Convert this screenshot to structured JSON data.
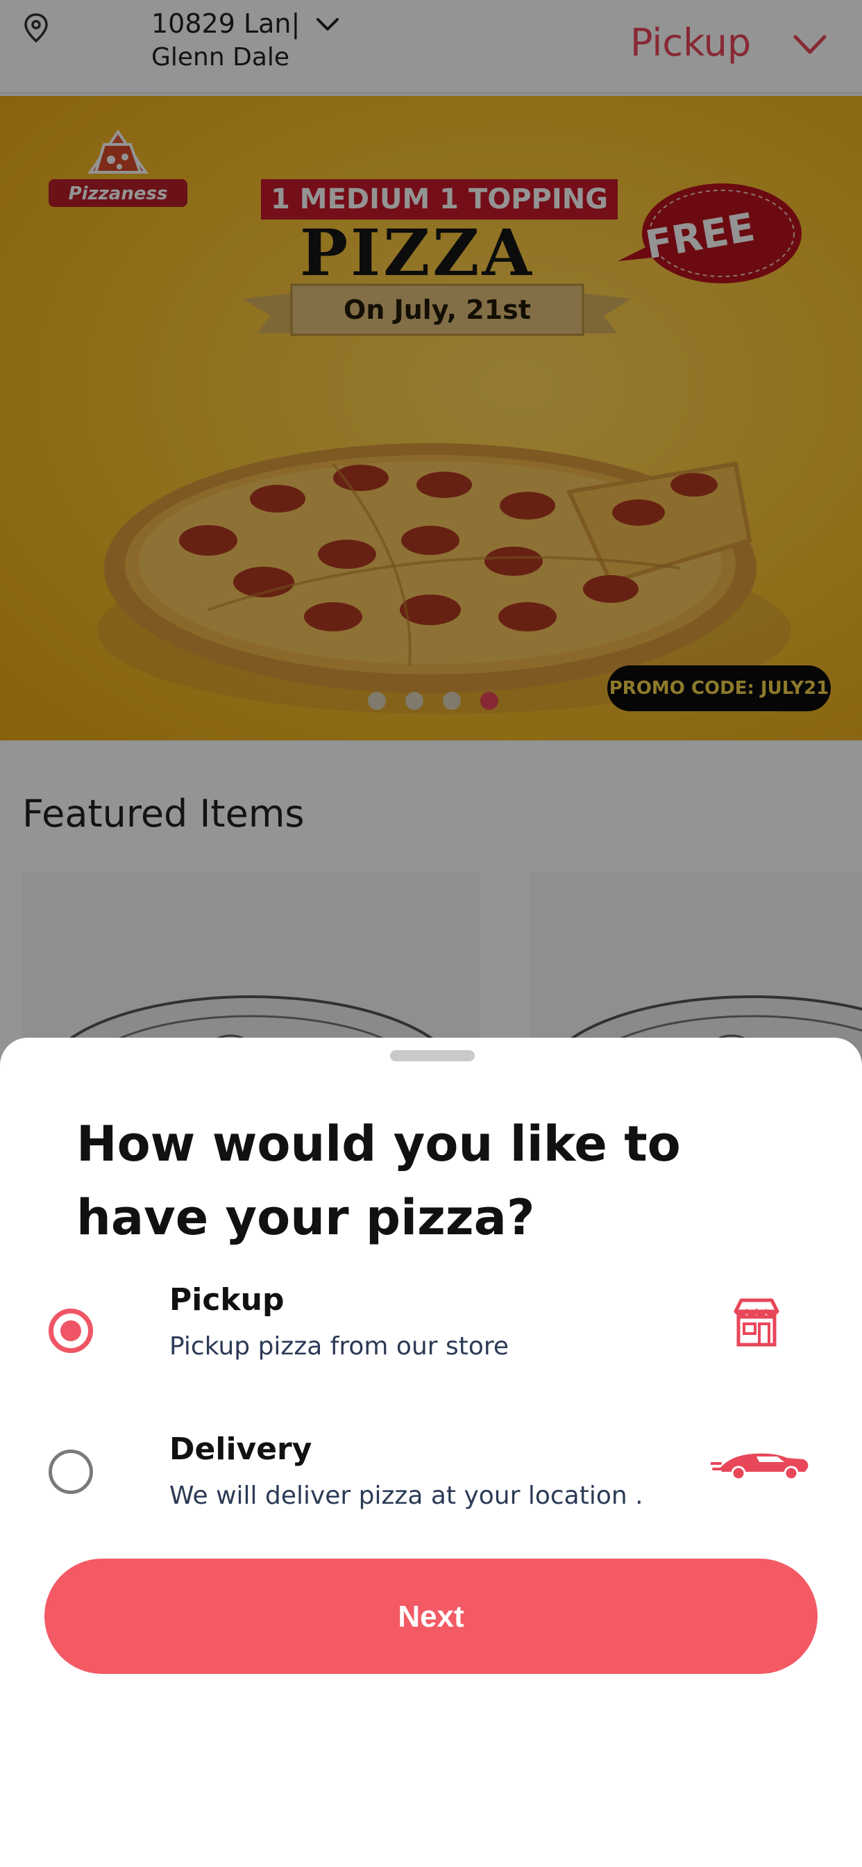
{
  "header": {
    "address_line1": "10829 Lan|",
    "address_line2": "Glenn Dale",
    "mode_label": "Pickup"
  },
  "banner": {
    "brand": "Pizzaness",
    "headline": "1 MEDIUM 1 TOPPING",
    "product": "PIZZA",
    "badge": "FREE",
    "date": "On July, 21st",
    "promo_code": "PROMO CODE: JULY21",
    "slide_count": 4,
    "active_slide": 4
  },
  "featured": {
    "title": "Featured Items"
  },
  "sheet": {
    "question": "How would you like to have your pizza?",
    "options": [
      {
        "title": "Pickup",
        "description": "Pickup pizza from our store",
        "selected": true,
        "icon": "store-icon"
      },
      {
        "title": "Delivery",
        "description": "We will deliver pizza at your location .",
        "selected": false,
        "icon": "car-icon"
      }
    ],
    "next_label": "Next"
  },
  "colors": {
    "accent": "#e8475a",
    "button": "#f35a64",
    "banner_bg": "#f6be2c",
    "overlay": "rgba(0,0,0,0.42)"
  }
}
